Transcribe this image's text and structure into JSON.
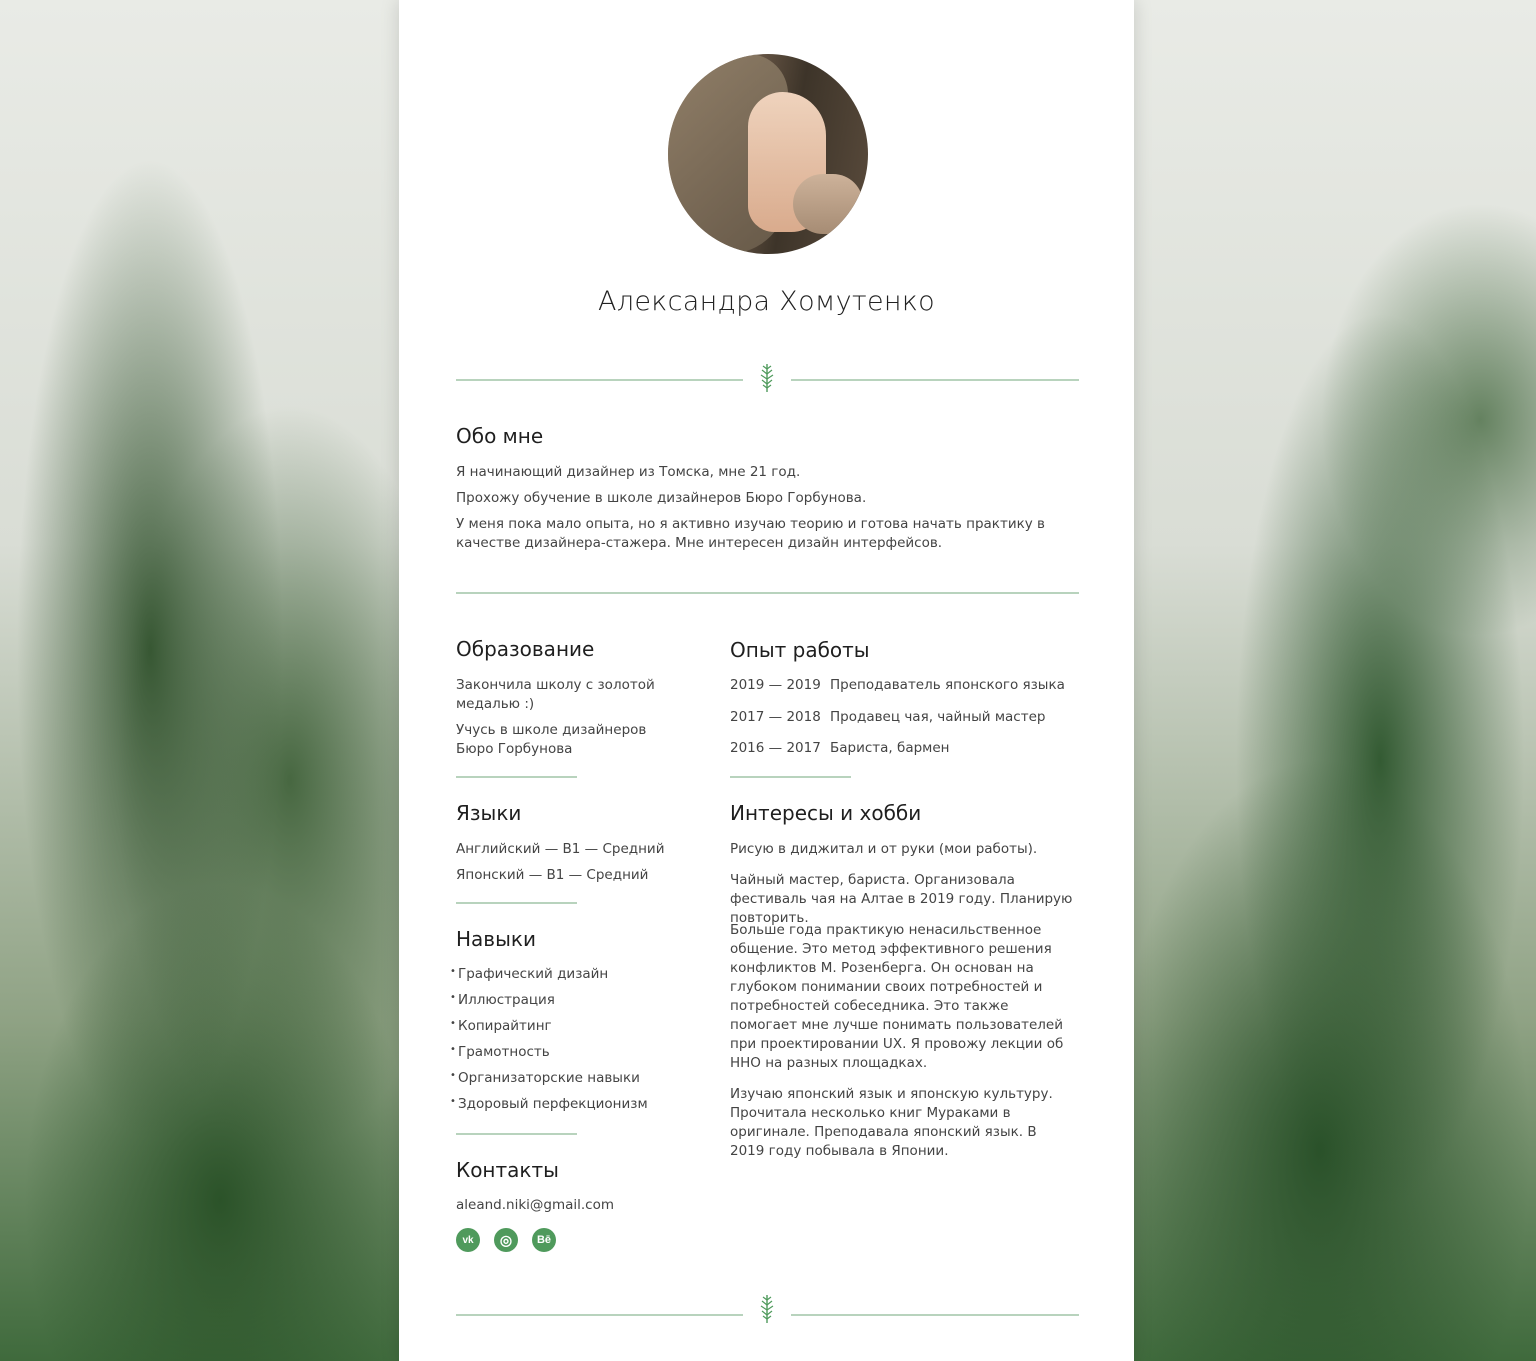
{
  "profile": {
    "name": "Александра Хомутенко"
  },
  "about": {
    "title": "Обо мне",
    "p1": "Я начинающий дизайнер из Томска, мне 21 год.",
    "p2": "Прохожу обучение в школе дизайнеров Бюро Горбунова.",
    "p3": "У меня пока мало опыта, но я активно изучаю теорию и готова начать практику в качестве дизайнера-стажера. Мне интересен дизайн интерфейсов."
  },
  "education": {
    "title": "Образование",
    "items": [
      "Закончила школу с золотой медалью :)",
      "Учусь в школе дизайнеров Бюро Горбунова"
    ]
  },
  "experience": {
    "title": "Опыт работы",
    "jobs": [
      {
        "years": "2019 — 2019",
        "title": "Преподаватель японского языка"
      },
      {
        "years": "2017 — 2018",
        "title": "Продавец чая, чайный мастер"
      },
      {
        "years": "2016 — 2017",
        "title": "Бариста,  бармен"
      }
    ]
  },
  "languages": {
    "title": "Языки",
    "items": [
      "Английский — B1 — Средний",
      "Японский — B1 — Средний"
    ]
  },
  "hobbies": {
    "title": "Интересы и хобби",
    "p1": "Рисую в диджитал и от руки (мои работы).",
    "p2": "Чайный мастер, бариста. Организовала фестиваль чая на Алтае в 2019 году. Планирую повторить.",
    "p3": "Больше года практикую ненасильственное общение. Это метод эффективного решения конфликтов М. Розенберга. Он основан на глубоком понимании своих потребностей и потребностей собеседника. Это также помогает мне лучше понимать пользователей при проектировании UX. Я провожу лекции об ННО на разных площадках.",
    "p4": "Изучаю японский язык и японскую культуру. Прочитала несколько книг Мураками в оригинале. Преподавала японский язык. В 2019 году побывала в Японии."
  },
  "skills": {
    "title": "Навыки",
    "items": [
      "Графический дизайн",
      "Иллюстрация",
      "Копирайтинг",
      "Грамотность",
      "Организаторские навыки",
      "Здоровый перфекционизм"
    ]
  },
  "contacts": {
    "title": "Контакты",
    "email": "aleand.niki@gmail.com",
    "social": [
      {
        "icon": "vk-icon",
        "glyph": "vk"
      },
      {
        "icon": "instagram-icon",
        "glyph": "◎"
      },
      {
        "icon": "behance-icon",
        "glyph": "Bē"
      }
    ]
  },
  "colors": {
    "accent": "#4f9a5c",
    "divider": "#b8d3bd"
  }
}
